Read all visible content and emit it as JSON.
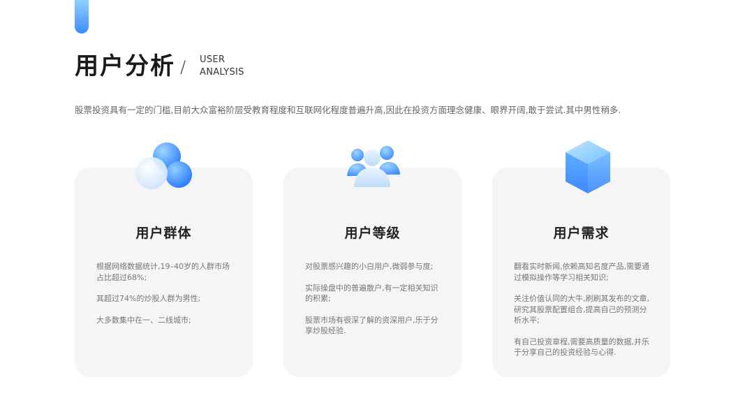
{
  "header": {
    "title": "用户分析",
    "slash": "/",
    "subtitle_line1": "USER",
    "subtitle_line2": "ANALYSIS"
  },
  "intro": "股票投资具有一定的门槛,目前大众富裕阶层受教育程度和互联网化程度普遍升高,因此在投资方面理念健康、眼界开阔,敢于尝试.其中男性稍多.",
  "cards": [
    {
      "title": "用户群体",
      "icon": "bubbles-icon",
      "items": [
        "根据网络数据统计,19–40岁的人群市场占比超过68%;",
        "其超过74%的炒股人群为男性;",
        "大多数集中在一、二线城市;"
      ]
    },
    {
      "title": "用户等级",
      "icon": "user-group-icon",
      "items": [
        "对股票感兴趣的小白用户,微弱参与度;",
        "实际操盘中的普遍散户,有一定相关知识的积累;",
        "股票市场有很深了解的资深用户,乐于分享炒股经验."
      ]
    },
    {
      "title": "用户需求",
      "icon": "cube-icon",
      "items": [
        "翻看实时新闻,依赖高知名度产品,需要通过模拟操作等学习相关知识;",
        "关注价值认同的大牛,刷刷其发布的文章,研究其股票配置组合,提高自己的预测分析水平;",
        "有自己投资章程,需要高质量的数据,并乐于分享自己的投资经验与心得."
      ]
    }
  ],
  "colors": {
    "accent": "#3d8bff",
    "card_bg": "#f5f5f6"
  }
}
